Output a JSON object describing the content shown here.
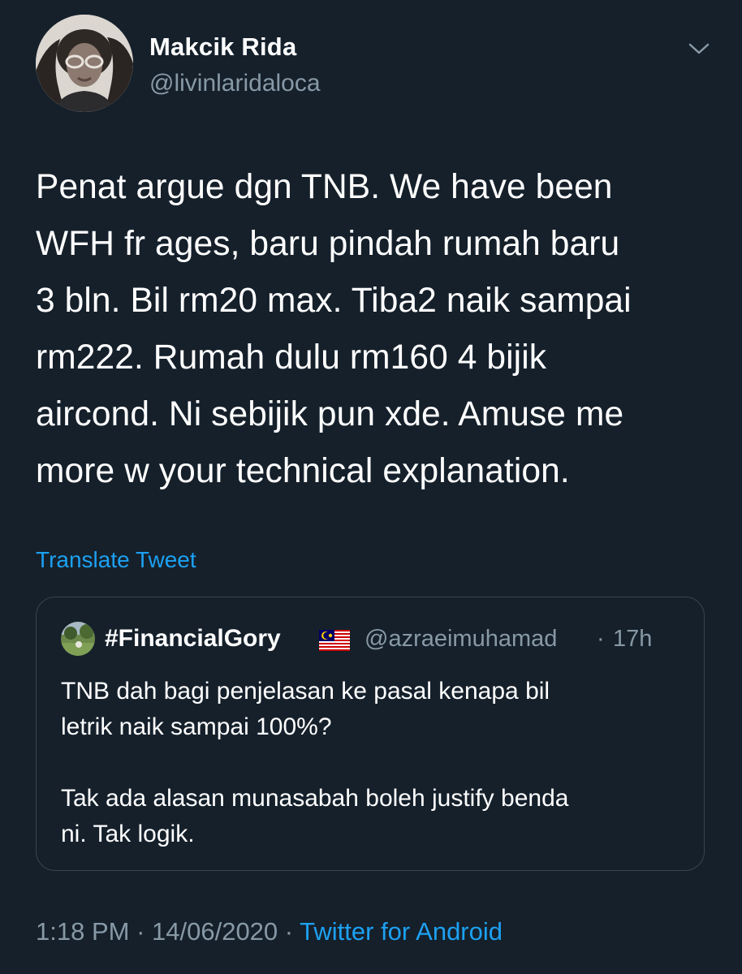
{
  "author": {
    "display_name": "Makcik Rida",
    "handle": "@livinlaridaloca"
  },
  "tweet": {
    "lines": [
      "Penat argue dgn TNB. We have been",
      "WFH fr ages, baru pindah rumah baru",
      "3 bln. Bil rm20 max. Tiba2 naik sampai",
      "rm222. Rumah dulu rm160 4 bijik",
      "aircond. Ni sebijik pun xde. Amuse me",
      "more w your technical explanation."
    ],
    "translate_label": "Translate Tweet"
  },
  "quoted_tweet": {
    "display_name": "#FinancialGory",
    "flag_icon": "malaysia-flag-icon",
    "handle": "@azraeimuhamad",
    "separator": "·",
    "time": "17h",
    "text": "TNB dah bagi penjelasan ke pasal kenapa bil\nletrik naik sampai 100%?\n\nTak ada alasan munasabah boleh justify benda\nni. Tak logik."
  },
  "footer": {
    "time": "1:18 PM",
    "separator1": " · ",
    "date": "14/06/2020",
    "separator2": " · ",
    "source": "Twitter for Android"
  },
  "colors": {
    "background": "#15202b",
    "text": "#ffffff",
    "secondary": "#8899a6",
    "link": "#1da1f2",
    "border": "#38444d"
  }
}
